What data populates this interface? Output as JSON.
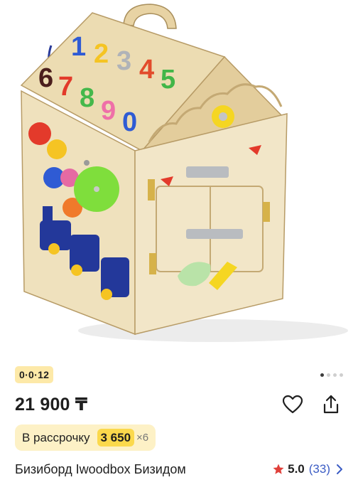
{
  "product": {
    "age_badge": "0·0·12",
    "price": "21 900 ₸",
    "installment": {
      "label": "В рассрочку",
      "amount": "3 650",
      "times": "×6"
    },
    "title": "Бизиборд Iwoodbox Бизидом",
    "rating": {
      "value": "5.0",
      "count": "(33)"
    },
    "gallery": {
      "total": 4,
      "active_index": 0
    },
    "illustration_numbers": [
      "1",
      "2",
      "3",
      "4",
      "5",
      "6",
      "7",
      "8",
      "9",
      "0"
    ]
  },
  "icons": {
    "favorite": "heart-icon",
    "share": "share-icon",
    "rating": "star-icon",
    "more": "chevron-right-icon"
  },
  "colors": {
    "badge_bg": "#fde9a8",
    "installment_bg": "#fdf1c6",
    "installment_amount_bg": "#fbd94c",
    "star": "#e0403a",
    "link": "#3b5cc4"
  }
}
